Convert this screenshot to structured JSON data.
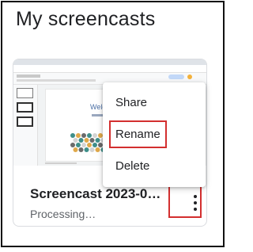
{
  "page": {
    "heading": "My screencasts"
  },
  "thumbnail": {
    "slide_title": "Welcome"
  },
  "screencast": {
    "title": "Screencast 2023-0…",
    "status": "Processing…"
  },
  "menu": {
    "items": [
      {
        "label": "Share"
      },
      {
        "label": "Rename"
      },
      {
        "label": "Delete"
      }
    ]
  },
  "icons": {
    "more": "more-vert-icon"
  },
  "colors": {
    "highlight": "#d32f2f",
    "text_primary": "#202124",
    "text_secondary": "#5f6368"
  }
}
